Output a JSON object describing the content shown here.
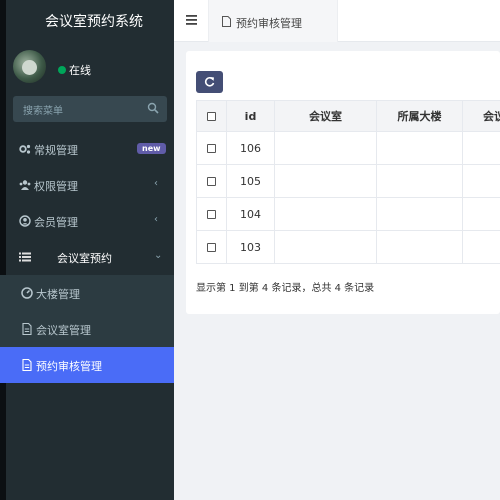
{
  "app": {
    "title": "会议室预约系统"
  },
  "user": {
    "status": "在线",
    "status_color": "#00a65a"
  },
  "sidebar": {
    "search_placeholder": "搜索菜单",
    "items": [
      {
        "label": "常规管理",
        "icon": "gears-icon",
        "badge": "new"
      },
      {
        "label": "权限管理",
        "icon": "group-icon",
        "caret": "‹"
      },
      {
        "label": "会员管理",
        "icon": "user-circle-icon",
        "caret": "‹"
      },
      {
        "label": "会议室预约",
        "icon": "list-icon",
        "caret": "⌄"
      }
    ],
    "sub_items": [
      {
        "label": "大楼管理",
        "icon": "dashboard-icon"
      },
      {
        "label": "会议室管理",
        "icon": "file-icon"
      },
      {
        "label": "预约审核管理",
        "icon": "file-icon",
        "active": true
      }
    ]
  },
  "topbar": {
    "tab_label": "预约审核管理"
  },
  "table": {
    "columns": [
      "",
      "id",
      "会议室",
      "所属大楼",
      "会议"
    ],
    "rows": [
      {
        "id": "106",
        "room": "",
        "building": ""
      },
      {
        "id": "105",
        "room": "",
        "building": ""
      },
      {
        "id": "104",
        "room": "",
        "building": ""
      },
      {
        "id": "103",
        "room": "",
        "building": ""
      }
    ]
  },
  "summary": "显示第 1 到第 4 条记录，总共 4 条记录",
  "colors": {
    "sidebar_bg": "#222d32",
    "active": "#4a6cf7",
    "badge": "#605ca8",
    "refresh_btn": "#444e75"
  }
}
